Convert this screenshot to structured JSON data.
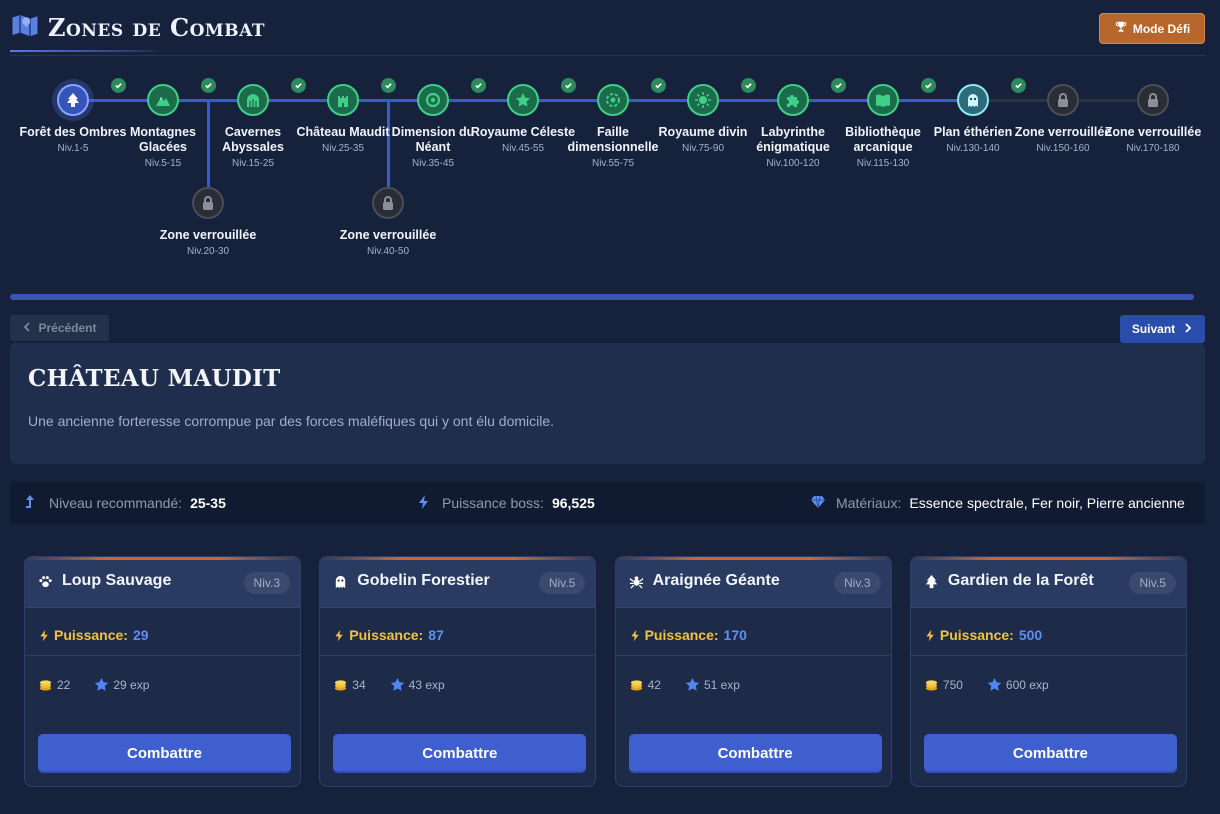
{
  "header": {
    "title": "Zones de Combat",
    "title_icon": "map-icon",
    "mode_button": "Mode Défi",
    "mode_icon": "trophy-icon"
  },
  "zones": [
    {
      "name": "Forêt des Ombres",
      "level": "Niv.1-5",
      "state": "current",
      "icon": "tree-icon"
    },
    {
      "name": "Montagnes Glacées",
      "level": "Niv.5-15",
      "state": "done",
      "icon": "mountain-icon"
    },
    {
      "name": "Cavernes Abyssales",
      "level": "Niv.15-25",
      "state": "done",
      "icon": "dungeon-icon"
    },
    {
      "name": "Château Maudit",
      "level": "Niv.25-35",
      "state": "done",
      "icon": "castle-icon"
    },
    {
      "name": "Dimension du Néant",
      "level": "Niv.35-45",
      "state": "done",
      "icon": "portal-icon"
    },
    {
      "name": "Royaume Céleste",
      "level": "Niv.45-55",
      "state": "done",
      "icon": "star-icon"
    },
    {
      "name": "Faille dimensionnelle",
      "level": "Niv.55-75",
      "state": "done",
      "icon": "rift-icon"
    },
    {
      "name": "Royaume divin",
      "level": "Niv.75-90",
      "state": "done",
      "icon": "sun-icon"
    },
    {
      "name": "Labyrinthe énigmatique",
      "level": "Niv.100-120",
      "state": "done",
      "icon": "puzzle-icon"
    },
    {
      "name": "Bibliothèque arcanique",
      "level": "Niv.115-130",
      "state": "done",
      "icon": "book-icon"
    },
    {
      "name": "Plan éthérien",
      "level": "Niv.130-140",
      "state": "ether",
      "icon": "ghost-icon"
    },
    {
      "name": "Zone verrouillée",
      "level": "Niv.150-160",
      "state": "locked",
      "icon": "lock-icon"
    },
    {
      "name": "Zone verrouillée",
      "level": "Niv.170-180",
      "state": "locked",
      "icon": "lock-icon"
    }
  ],
  "branch_zones": [
    {
      "name": "Zone verrouillée",
      "level": "Niv.20-30",
      "state": "locked",
      "icon": "lock-icon"
    },
    {
      "name": "Zone verrouillée",
      "level": "Niv.40-50",
      "state": "locked",
      "icon": "lock-icon"
    }
  ],
  "map_progress_fraction": 1.0,
  "nav": {
    "prev": "Précédent",
    "next": "Suivant"
  },
  "zone": {
    "title": "CHÂTEAU MAUDIT",
    "description": "Une ancienne forteresse corrompue par des forces maléfiques qui y ont élu domicile."
  },
  "stats": {
    "level_label": "Niveau recommandé:",
    "level_value": "25-35",
    "boss_label": "Puissance boss:",
    "boss_value": "96,525",
    "materials_label": "Matériaux:",
    "materials_value": "Essence spectrale, Fer noir, Pierre ancienne"
  },
  "monsters": [
    {
      "name": "Loup Sauvage",
      "level": "Niv.3",
      "power_label": "Puissance:",
      "power": "29",
      "gold": "22",
      "exp": "29 exp",
      "icon": "paw-icon",
      "button": "Combattre"
    },
    {
      "name": "Gobelin Forestier",
      "level": "Niv.5",
      "power_label": "Puissance:",
      "power": "87",
      "gold": "34",
      "exp": "43 exp",
      "icon": "ghost-icon",
      "button": "Combattre"
    },
    {
      "name": "Araignée Géante",
      "level": "Niv.3",
      "power_label": "Puissance:",
      "power": "170",
      "gold": "42",
      "exp": "51 exp",
      "icon": "spider-icon",
      "button": "Combattre"
    },
    {
      "name": "Gardien de la Forêt",
      "level": "Niv.5",
      "power_label": "Puissance:",
      "power": "500",
      "gold": "750",
      "exp": "600 exp",
      "icon": "tree-icon",
      "button": "Combattre"
    }
  ],
  "colors": {
    "accent": "#3f5fcf",
    "done": "#3fcf89",
    "power": "#f2c23d",
    "mode_button": "#b8672c"
  }
}
